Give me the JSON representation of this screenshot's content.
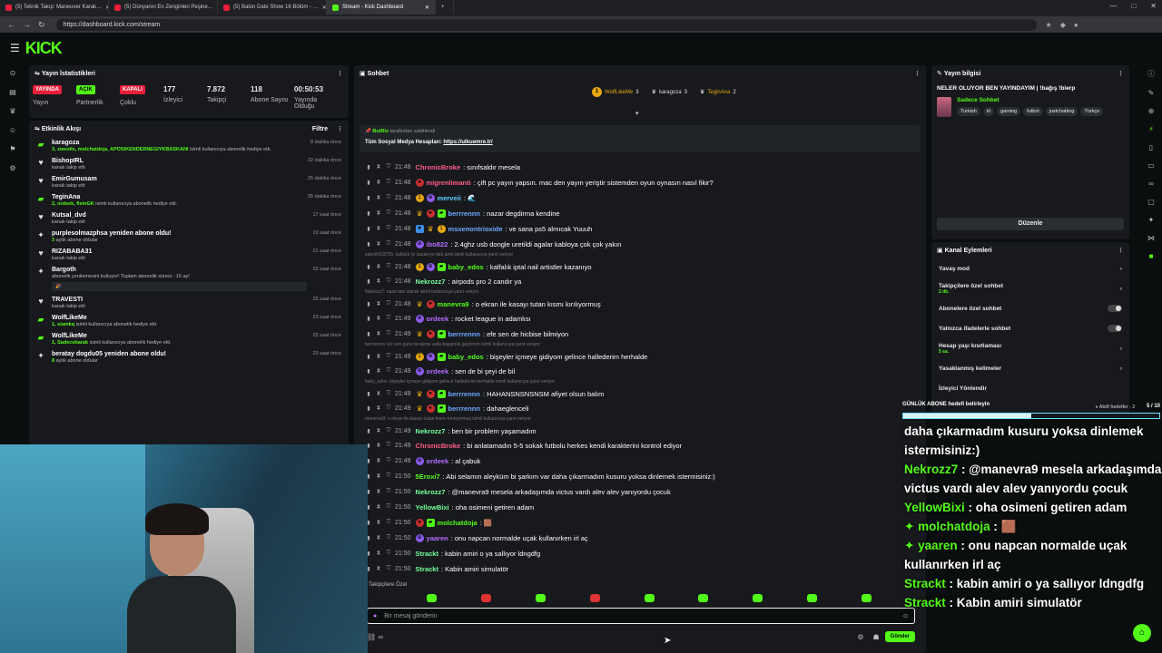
{
  "browser": {
    "tabs": [
      {
        "label": "(5) Teknik Takıp: Maneuver Karak…",
        "color": "#e91e3a"
      },
      {
        "label": "(5) Dünyanın En Zenginleri Peşine…",
        "color": "#e91e3a"
      },
      {
        "label": "(5) Balon Date Show 16 Bölüm - …",
        "color": "#e91e3a"
      },
      {
        "label": "Stream - Kick Dashboard",
        "color": "#53fc18"
      }
    ],
    "url": "https://dashboard.kick.com/stream"
  },
  "brand": {
    "logo": "KICK",
    "accent": "#53fc18"
  },
  "stats": {
    "title": "Yayın İstatistikleri",
    "items": [
      {
        "badge": "YAYINDA",
        "label": "Yayın",
        "type": "red"
      },
      {
        "badge": "AÇIK",
        "label": "Partnerlik",
        "type": "green"
      },
      {
        "badge": "KAPALI",
        "label": "Çoklu",
        "type": "red"
      },
      {
        "value": "177",
        "label": "İzleyici"
      },
      {
        "value": "7.872",
        "label": "Takipçi"
      },
      {
        "value": "118",
        "label": "Abone Sayısı"
      },
      {
        "value": "00:50:53",
        "label": "Yayında Olduğu"
      }
    ]
  },
  "activity": {
    "title": "Etkinlik Akışı",
    "filter": "Filtre",
    "items": [
      {
        "icon": "gift",
        "name": "karagoza",
        "desc_hl": "3, zwenils, molchatdoja, APOSIKENDERNEGIYKBASKANI",
        "desc": " isimli kullanıcıya abonelik hediye etti.",
        "time": "8 dakika önce"
      },
      {
        "icon": "heart",
        "name": "BishopIRL",
        "desc_hl": "",
        "desc": "kanalı takip etti",
        "time": "22 dakika önce"
      },
      {
        "icon": "heart",
        "name": "EmirGumusam",
        "desc_hl": "",
        "desc": "kanalı takip etti",
        "time": "25 dakika önce"
      },
      {
        "icon": "gift",
        "name": "TeginAna",
        "desc_hl": "2, ordeek, fleinGK",
        "desc": " isimli kullanıcıya abonelik hediye etti.",
        "time": "35 dakika önce"
      },
      {
        "icon": "heart",
        "name": "Kutsal_dvd",
        "desc_hl": "",
        "desc": "kanalı takip etti",
        "time": "17 saat önce"
      },
      {
        "icon": "star",
        "name": "purplesolmazphsa yeniden abone oldu!",
        "desc_hl": "3",
        "desc": " aylık abone oldular",
        "time": "19 saat önce"
      },
      {
        "icon": "heart",
        "name": "RIZABABA31",
        "desc_hl": "",
        "desc": "kanalı takip etti",
        "time": "21 saat önce"
      },
      {
        "icon": "star",
        "name": "Bargoth",
        "desc_hl": "",
        "desc": "abonelik yenilemesini kutluyor! Toplam abonelik süresi - 16 ay!",
        "time": "22 saat önce",
        "quote": "🎉"
      },
      {
        "icon": "heart",
        "name": "TRAVESTI",
        "desc_hl": "",
        "desc": "kanalı takip etti",
        "time": "22 saat önce"
      },
      {
        "icon": "gift",
        "name": "WolfLikeMe",
        "desc_hl": "1, siamkq",
        "desc": " isimli kullanıcıya abonelik hediye etti.",
        "time": "23 saat önce"
      },
      {
        "icon": "gift",
        "name": "WolfLikeMe",
        "desc_hl": "1, Sadecebarak",
        "desc": " isimli kullanıcıya abonelik hediye etti.",
        "time": "23 saat önce"
      },
      {
        "icon": "star",
        "name": "beratay dogdu05 yeniden abone oldu!",
        "desc_hl": "8",
        "desc": " aylık abone oldular",
        "time": "23 saat önce"
      }
    ]
  },
  "chat": {
    "title": "Sohbet",
    "leaders": [
      {
        "name": "WolfLikeMe",
        "count": "3"
      },
      {
        "name": "karagoza",
        "count": "3"
      },
      {
        "name": "TeginAna",
        "count": "2"
      }
    ],
    "pinned": {
      "by": "BotRix",
      "by_suffix": " tarafından sabitlendi",
      "text": "Tüm Sosyal Medya Hesapları: ",
      "link": "https://ulkuemre.tr/"
    },
    "messages": [
      {
        "time": "21:48",
        "badges": [],
        "user": "ChronicBroke",
        "color": "#ff5c8a",
        "text": ": sınıfsaldır mesela"
      },
      {
        "time": "21:48",
        "badges": [
          "r"
        ],
        "user": "migrenlimanti",
        "color": "#ff5c8a",
        "text": ": çift pc yayın yapsın. mac den yayın yeriştir sistemden oyun oynasın nasıl fikir?"
      },
      {
        "time": "21:48",
        "badges": [
          "o",
          "p"
        ],
        "user": "merveii",
        "color": "#5dd0ff",
        "text": ": 🌊"
      },
      {
        "time": "21:48",
        "badges": [
          "cr",
          "r",
          "g"
        ],
        "user": "berrrennn",
        "color": "#6fa8ff",
        "text": ": nazar degdirma kendine"
      },
      {
        "time": "21:48",
        "badges": [
          "b",
          "cr",
          "o"
        ],
        "user": "msxenontrioxide",
        "color": "#6fa8ff",
        "text": ": ve sana ps5 almıcak Yuuuh"
      },
      {
        "time": "21:48",
        "badges": [
          "p"
        ],
        "user": "ibo822",
        "color": "#b46cff",
        "text": ": 2.4ghz usb dongle uretildi agalar kabloya çok çok yakın"
      },
      {
        "time": "21:48",
        "badges": [
          "o",
          "p",
          "g"
        ],
        "user": "baby_edos",
        "color": "#53fc18",
        "text": ": kalfalık iptal nail artistler kazanıyo",
        "reply": "sabotNO3755: kalfalık iyi kazanıyo tatlı amk isimli kullanıcıya yanıt veriyor"
      },
      {
        "time": "21:48",
        "badges": [],
        "user": "Nekrozz7",
        "color": "#77ff9e",
        "text": ": airpods pro 2 candır ya"
      },
      {
        "time": "21:48",
        "badges": [
          "cr",
          "r"
        ],
        "user": "manevra9",
        "color": "#53fc18",
        "text": ": o ekran ile kasayı tutan kısmı kırılıyormuş",
        "reply": "Nekrozz7: nasıl tam olarak isimli kullanıcıya yanıt veriyor"
      },
      {
        "time": "21:49",
        "badges": [
          "p"
        ],
        "user": "ordeek",
        "color": "#b46cff",
        "text": ": rocket league in adamlısı"
      },
      {
        "time": "21:49",
        "badges": [
          "cr",
          "r",
          "g"
        ],
        "user": "berrrennn",
        "color": "#6fa8ff",
        "text": ": efe sen de hicbise bilmiyon"
      },
      {
        "time": "21:49",
        "badges": [
          "o",
          "p",
          "g"
        ],
        "user": "baby_edos",
        "color": "#53fc18",
        "text": ": bişeyler içmeye gidiyom gelince hallederim herhalde",
        "reply": "berrrennn: k/z son gune bırakma valla baygınlık geçirirsin isimli kullanıcıya yanıt veriyor"
      },
      {
        "time": "21:49",
        "badges": [
          "p"
        ],
        "user": "ordeek",
        "color": "#b46cff",
        "text": ": sen de bi şeyi de bil"
      },
      {
        "time": "21:49",
        "badges": [
          "cr",
          "r",
          "g"
        ],
        "user": "berrrennn",
        "color": "#6fa8ff",
        "text": ": HAHANSNSNSNSM afiyet olsun balım",
        "reply": "baby_edos: bişeyler içmeye gidiyom gelince hallederim herhalde isimli kullanıcıya yanıt veriyor"
      },
      {
        "time": "21:49",
        "badges": [
          "cr",
          "r",
          "g"
        ],
        "user": "berrrennn",
        "color": "#6fa8ff",
        "text": ": dahaeglenceli"
      },
      {
        "time": "21:49",
        "badges": [],
        "user": "Nekrozz7",
        "color": "#77ff9e",
        "text": ": ben bir problem yaşamadım",
        "reply": "manevra9: o ekran ile kasayı tutan kısmı kırılıyormuş isimli kullanıcıya yanıt veriyor"
      },
      {
        "time": "21:49",
        "badges": [],
        "user": "ChronicBroke",
        "color": "#ff5c8a",
        "text": ": bi anlatamadın 5-5 sokak futbolu herkes kendi karakterini kontrol ediyor"
      },
      {
        "time": "21:49",
        "badges": [
          "p"
        ],
        "user": "ordeek",
        "color": "#b46cff",
        "text": ": al çabuk"
      },
      {
        "time": "21:50",
        "badges": [],
        "user": "5Eroxi7",
        "color": "#53fc18",
        "text": ": Abi selamın aleyküm bi şarkım var daha çıkarmadım kusuru yoksa dinlemek istermisiniz:)"
      },
      {
        "time": "21:50",
        "badges": [],
        "user": "Nekrozz7",
        "color": "#77ff9e",
        "text": ": @manevra9 mesela arkadaşımda victus vardı alev alev yanıyordu çocuk"
      },
      {
        "time": "21:50",
        "badges": [],
        "user": "YellowBixi",
        "color": "#77ff9e",
        "text": ": oha osimeni getiren adam"
      },
      {
        "time": "21:50",
        "badges": [
          "r",
          "g"
        ],
        "user": "molchatdoja",
        "color": "#53fc18",
        "text": ": 🟫"
      },
      {
        "time": "21:50",
        "badges": [
          "p"
        ],
        "user": "yaaren",
        "color": "#b46cff",
        "text": ": onu napcan normalde uçak kullanırken irl aç"
      },
      {
        "time": "21:50",
        "badges": [],
        "user": "Strackt",
        "color": "#77ff9e",
        "text": ": kabin amiri o ya sallıyor ldngdfg"
      },
      {
        "time": "21:50",
        "badges": [],
        "user": "Strackt",
        "color": "#77ff9e",
        "text": ": Kabin amiri simulatör"
      }
    ],
    "followers_only": "Takipçilere Özel",
    "placeholder": "Bir mesaj gönderin",
    "send": "Gönder"
  },
  "info": {
    "title": "Yayın bilgisi",
    "stream_title": "NELER OLUYOR BEN YAYINDAYIM | !bağış !bierp",
    "category": "Sadece Sohbet",
    "tags": [
      "Turkish",
      "irl",
      "gaming",
      "futbol",
      "justchatting",
      "Türkçe"
    ],
    "edit": "Düzenle"
  },
  "actions": {
    "title": "Kanal Eylemleri",
    "items": [
      {
        "label": "Yavaş mod",
        "sub": "",
        "kind": "arrow"
      },
      {
        "label": "Takipçilere özel sohbet",
        "sub": "2 dk.",
        "kind": "arrow"
      },
      {
        "label": "Abonelere özel sohbet",
        "sub": "",
        "kind": "toggle"
      },
      {
        "label": "Yalnızca ifadelerle sohbet",
        "sub": "",
        "kind": "toggle"
      },
      {
        "label": "Hesap yaşı kısıtlaması",
        "sub": "5 sa.",
        "kind": "arrow"
      },
      {
        "label": "Yasaklanmış kelimeler",
        "sub": "",
        "kind": "arrow"
      },
      {
        "label": "İzleyici Yönlendir",
        "sub": "",
        "kind": "none"
      }
    ]
  },
  "overlay": {
    "goal_label": "GÜNLÜK ABONE",
    "goal_sub": "hedefi belirleyin",
    "goal_hedef": "● Aktif hedefler - 2",
    "goal_count": "5 / 10",
    "goal_progress": 0.5,
    "lines": [
      {
        "name": "",
        "star": false,
        "text": "daha çıkarmadım kusuru yoksa dinlemek istermisiniz:)"
      },
      {
        "name": "Nekrozz7",
        "star": false,
        "text": " : @manevra9 mesela arkadaşımda victus vardı alev alev yanıyordu çocuk"
      },
      {
        "name": "YellowBixi",
        "star": false,
        "text": " : oha osimeni getiren adam"
      },
      {
        "name": "molchatdoja",
        "star": true,
        "text": " : 🟫"
      },
      {
        "name": "yaaren",
        "star": true,
        "text": " : onu napcan normalde uçak kullanırken irl aç"
      },
      {
        "name": "Strackt",
        "star": false,
        "text": " : kabin amiri o ya sallıyor ldngdfg"
      },
      {
        "name": "Strackt",
        "star": false,
        "text": " : Kabin amiri simulatör"
      }
    ]
  }
}
